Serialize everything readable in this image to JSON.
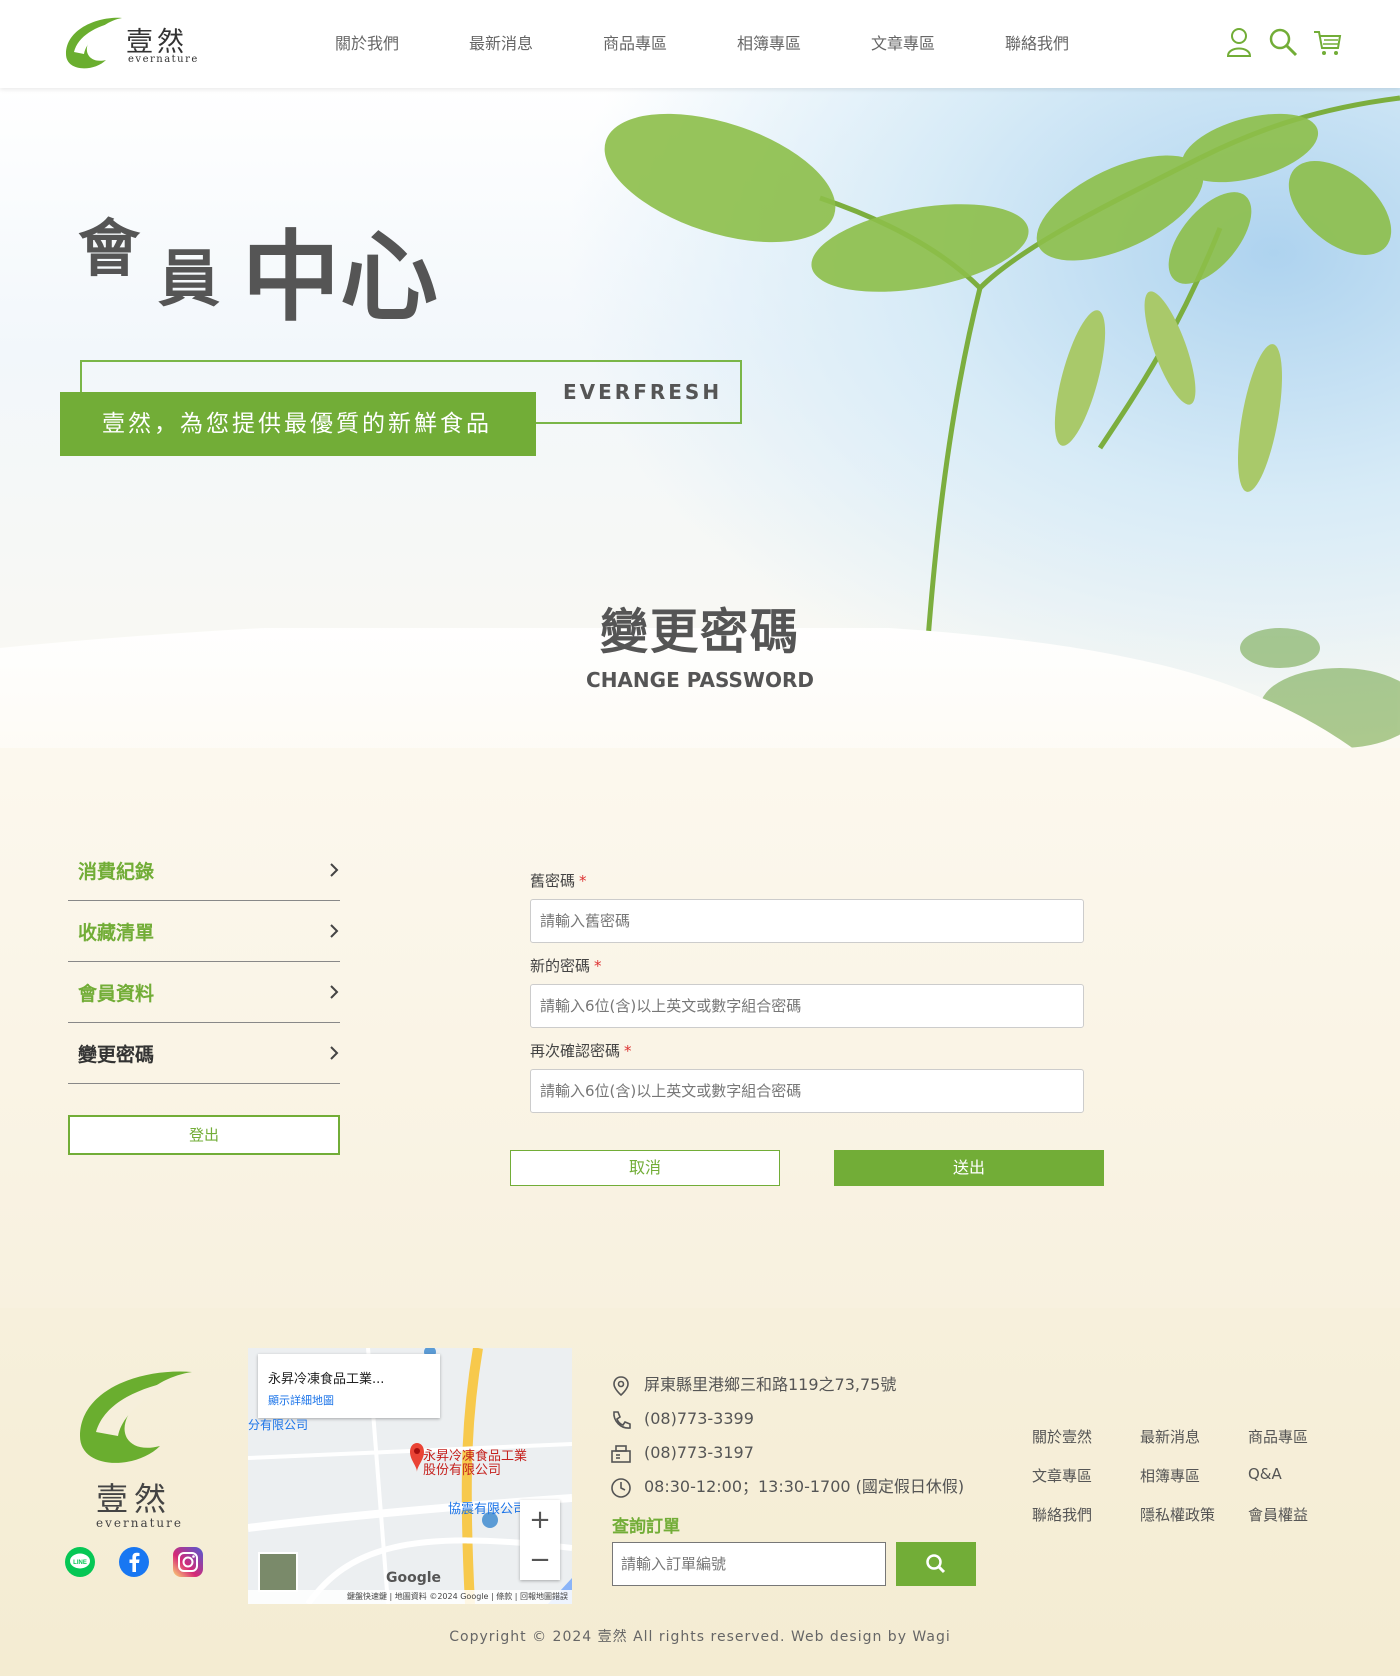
{
  "brand": {
    "name_zh": "壹然",
    "name_en": "evernature",
    "accent": "#72ad37"
  },
  "nav": [
    "關於我們",
    "最新消息",
    "商品專區",
    "相簿專區",
    "文章專區",
    "聯絡我們"
  ],
  "header_icons": [
    "user-icon",
    "search-icon",
    "cart-icon"
  ],
  "hero": {
    "title_chars": [
      "會",
      "員",
      "中心"
    ],
    "tag_en": "EVERFRESH",
    "tagline": "壹然，為您提供最優質的新鮮食品"
  },
  "section": {
    "title_zh": "變更密碼",
    "title_en": "CHANGE PASSWORD"
  },
  "sidebar": {
    "items": [
      {
        "label": "消費紀錄"
      },
      {
        "label": "收藏清單"
      },
      {
        "label": "會員資料"
      },
      {
        "label": "變更密碼",
        "active": true
      }
    ],
    "logout": "登出"
  },
  "form": {
    "old_password": {
      "label": "舊密碼",
      "required": "*",
      "placeholder": "請輸入舊密碼"
    },
    "new_password": {
      "label": "新的密碼",
      "required": "*",
      "placeholder": "請輸入6位(含)以上英文或數字組合密碼"
    },
    "confirm_password": {
      "label": "再次確認密碼",
      "required": "*",
      "placeholder": "請輸入6位(含)以上英文或數字組合密碼"
    },
    "cancel": "取消",
    "submit": "送出"
  },
  "map": {
    "place_name": "永昇冷凍食品工業...",
    "view_larger": "顯示詳細地圖",
    "pin_label_1": "永昇冷凍食品工業",
    "pin_label_2": "股份有限公司",
    "nearby_1": "協震有限公司",
    "nearby_2": "分有限公司",
    "google": "Google",
    "footer_text": "鍵盤快速鍵 | 地圖資料 ©2024 Google | 條款 | 回報地圖錯誤",
    "zoom_in": "+",
    "zoom_out": "−"
  },
  "contact": {
    "address": "屏東縣里港鄉三和路119之73,75號",
    "phone": "(08)773-3399",
    "fax": "(08)773-3197",
    "hours": "08:30-12:00；13:30-1700 (國定假日休假)"
  },
  "order_query": {
    "title": "查詢訂單",
    "placeholder": "請輸入訂單編號"
  },
  "footer_links": [
    "關於壹然",
    "最新消息",
    "商品專區",
    "文章專區",
    "相簿專區",
    "Q&A",
    "聯絡我們",
    "隱私權政策",
    "會員權益"
  ],
  "socials": [
    "line-icon",
    "facebook-icon",
    "instagram-icon"
  ],
  "copyright": "Copyright © 2024 壹然 All rights reserved. Web design by Wagi"
}
